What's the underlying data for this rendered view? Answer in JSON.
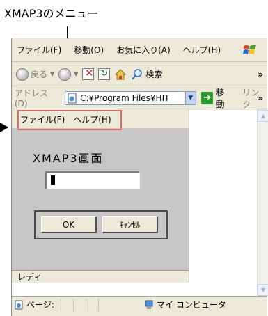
{
  "callout": {
    "label": "XMAP3のメニュー"
  },
  "browser": {
    "menu": [
      "ファイル(F)",
      "移動(O)",
      "お気に入り(A)",
      "ヘルプ(H)"
    ],
    "toolbar": {
      "back_label": "戻る",
      "search_label": "検索",
      "more": "»"
    },
    "address": {
      "label": "アドレス(D)",
      "value": "C:¥Program Files¥HIT",
      "go_label": "移動",
      "links_label": "リンク",
      "more": "»"
    },
    "status": {
      "page": "ページ:",
      "zone": "マイ コンピュータ"
    }
  },
  "app": {
    "menu": [
      "ファイル(F)",
      "ヘルプ(H)"
    ],
    "title": "XMAP3画面",
    "ok_label": "OK",
    "cancel_label": "ｷｬﾝｾﾙ",
    "status": "レディ"
  },
  "colors": {
    "highlight": "#e06a6a",
    "app_background": "#c7c7c7",
    "chrome": "#ece9d8",
    "go_green": "#2e9b2e"
  }
}
